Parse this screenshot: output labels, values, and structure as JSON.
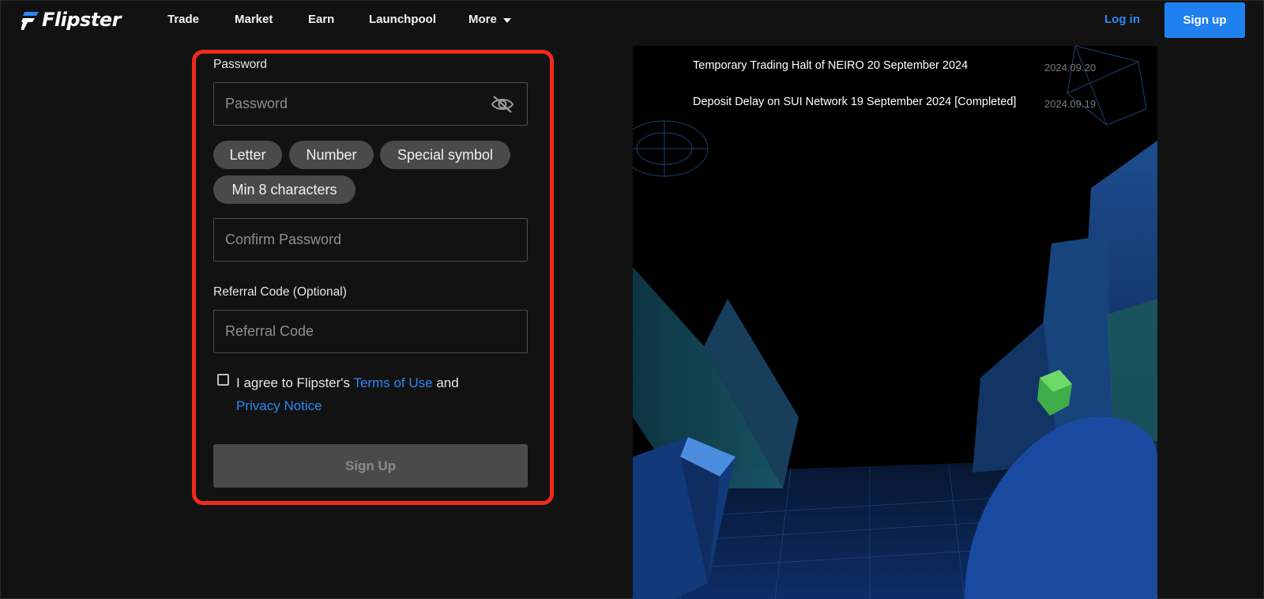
{
  "brand": {
    "name": "Flipster"
  },
  "nav": {
    "items": [
      "Trade",
      "Market",
      "Earn",
      "Launchpool"
    ],
    "more_label": "More",
    "login_label": "Log in",
    "signup_label": "Sign up"
  },
  "form": {
    "password_label": "Password",
    "password_placeholder": "Password",
    "requirements": [
      "Letter",
      "Number",
      "Special symbol",
      "Min 8 characters"
    ],
    "confirm_placeholder": "Confirm Password",
    "referral_label": "Referral Code (Optional)",
    "referral_placeholder": "Referral Code",
    "agree_prefix": "I agree to Flipster's ",
    "terms_link": "Terms of Use",
    "agree_and": " and",
    "privacy_link": "Privacy Notice",
    "submit_label": "Sign Up"
  },
  "announcements": [
    {
      "title": "Temporary Trading Halt of NEIRO 20 September 2024",
      "date": "2024.09.20"
    },
    {
      "title": "Deposit Delay on SUI Network 19 September 2024 [Completed]",
      "date": "2024.09.19"
    }
  ],
  "colors": {
    "accent": "#1f80f0",
    "link": "#2f86f6",
    "highlight_border": "#f02a1c",
    "background": "#121212",
    "chip": "#4a4a4a"
  },
  "icons": {
    "logo": "flipster-logo-icon",
    "eye": "eye-off-icon",
    "caret": "chevron-down-icon",
    "checkbox": "checkbox-unchecked-icon"
  }
}
